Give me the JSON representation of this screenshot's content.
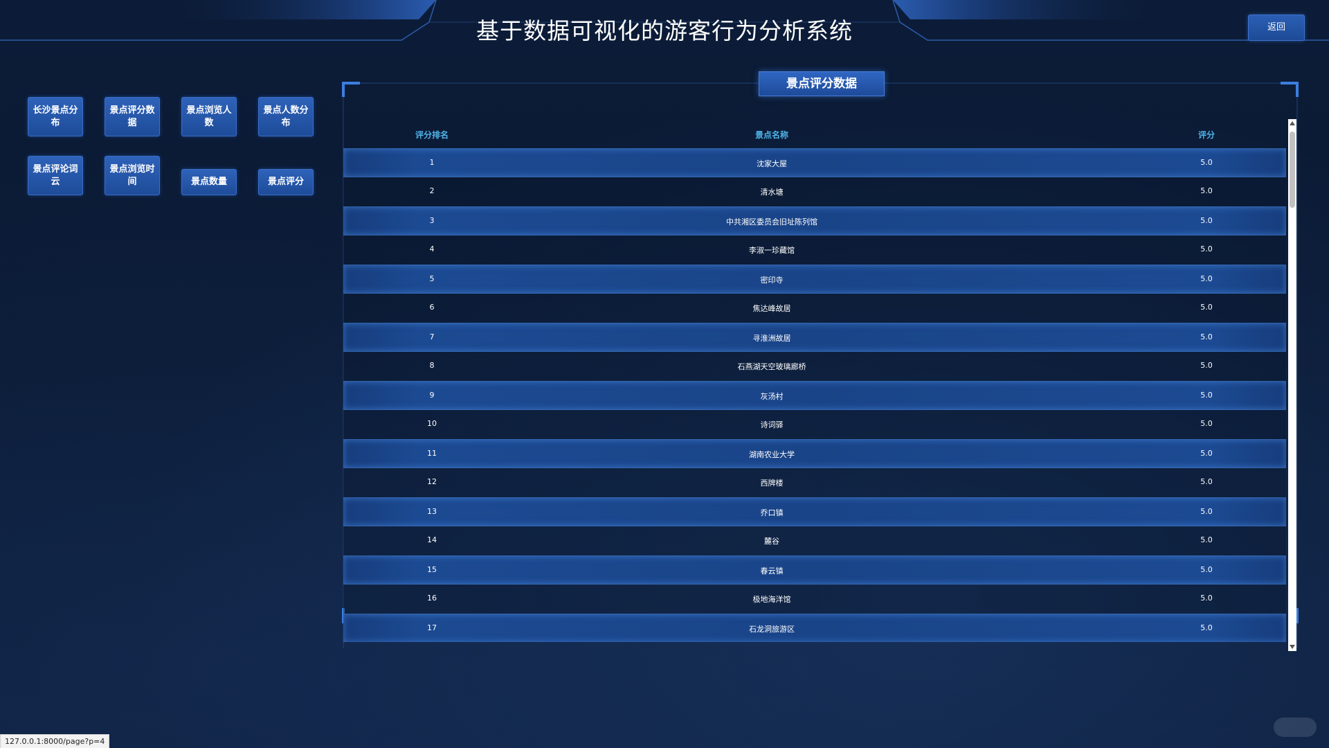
{
  "header": {
    "title": "基于数据可视化的游客行为分析系统",
    "back_label": "返回"
  },
  "nav": {
    "items": [
      {
        "label": "长沙景点分布"
      },
      {
        "label": "景点评分数据"
      },
      {
        "label": "景点浏览人数"
      },
      {
        "label": "景点人数分布"
      },
      {
        "label": "景点评论词云"
      },
      {
        "label": "景点浏览时间"
      },
      {
        "label": "景点数量"
      },
      {
        "label": "景点评分"
      }
    ]
  },
  "panel": {
    "title": "景点评分数据",
    "columns": {
      "rank": "评分排名",
      "name": "景点名称",
      "score": "评分"
    },
    "rows": [
      {
        "rank": "1",
        "name": "沈家大屋",
        "score": "5.0"
      },
      {
        "rank": "2",
        "name": "清水塘",
        "score": "5.0"
      },
      {
        "rank": "3",
        "name": "中共湘区委员会旧址陈列馆",
        "score": "5.0"
      },
      {
        "rank": "4",
        "name": "李淑一珍藏馆",
        "score": "5.0"
      },
      {
        "rank": "5",
        "name": "密印寺",
        "score": "5.0"
      },
      {
        "rank": "6",
        "name": "焦达峰故居",
        "score": "5.0"
      },
      {
        "rank": "7",
        "name": "寻淮洲故居",
        "score": "5.0"
      },
      {
        "rank": "8",
        "name": "石燕湖天空玻璃廊桥",
        "score": "5.0"
      },
      {
        "rank": "9",
        "name": "灰汤村",
        "score": "5.0"
      },
      {
        "rank": "10",
        "name": "诗词驿",
        "score": "5.0"
      },
      {
        "rank": "11",
        "name": "湖南农业大学",
        "score": "5.0"
      },
      {
        "rank": "12",
        "name": "西牌楼",
        "score": "5.0"
      },
      {
        "rank": "13",
        "name": "乔口镇",
        "score": "5.0"
      },
      {
        "rank": "14",
        "name": "麓谷",
        "score": "5.0"
      },
      {
        "rank": "15",
        "name": "春云镇",
        "score": "5.0"
      },
      {
        "rank": "16",
        "name": "极地海洋馆",
        "score": "5.0"
      },
      {
        "rank": "17",
        "name": "石龙洞旅游区",
        "score": "5.0"
      }
    ]
  },
  "status": {
    "url": "127.0.0.1:8000/page?p=4"
  },
  "colors": {
    "background": "#0b1a33",
    "button": "#1e4c99",
    "header_text": "#4fb3e8",
    "row_highlight": "#1a4488"
  }
}
